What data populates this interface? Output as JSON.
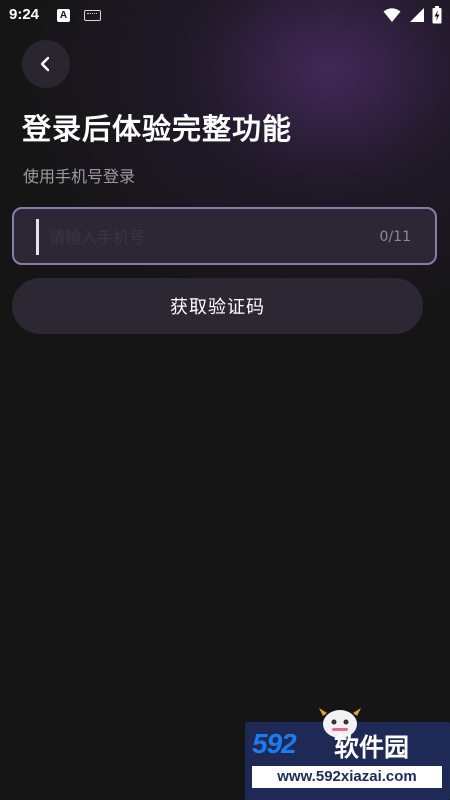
{
  "status_bar": {
    "time": "9:24",
    "notification_icons": [
      "a-icon",
      "keyboard-icon"
    ],
    "system_icons": [
      "wifi-icon",
      "signal-icon",
      "battery-charging-icon"
    ]
  },
  "header": {
    "back_icon": "chevron-left-icon",
    "title": "登录后体验完整功能",
    "subtitle": "使用手机号登录"
  },
  "phone_field": {
    "placeholder": "请输入手机号",
    "value": "",
    "counter": "0/11"
  },
  "actions": {
    "get_code_label": "获取验证码"
  },
  "watermark": {
    "brand_number": "592",
    "brand_name": "软件园",
    "url": "www.592xiazai.com"
  },
  "colors": {
    "background": "#151515",
    "accent_border": "#8a7ca8",
    "button_bg": "#2b2833",
    "watermark_blue": "#1b7cf0"
  }
}
